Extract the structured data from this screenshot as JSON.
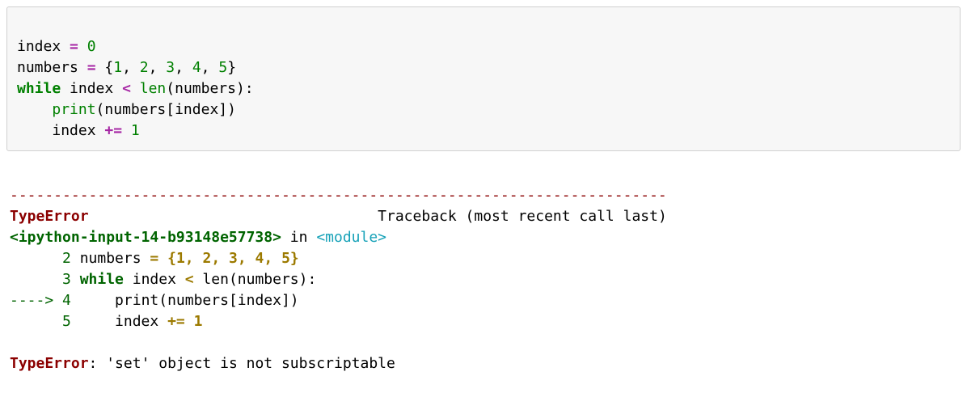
{
  "code": {
    "l1": {
      "v1": "index",
      "op": "=",
      "n1": "0"
    },
    "l2": {
      "v1": "numbers",
      "op": "=",
      "lb": "{",
      "n1": "1",
      "c1": ",",
      "n2": "2",
      "c2": ",",
      "n3": "3",
      "c3": ",",
      "n4": "4",
      "c4": ",",
      "n5": "5",
      "rb": "}"
    },
    "l3": {
      "kw": "while",
      "v1": "index",
      "op": "<",
      "fn": "len",
      "lp": "(",
      "v2": "numbers",
      "rp": "):"
    },
    "l4": {
      "fn": "print",
      "lp": "(",
      "v1": "numbers",
      "lb": "[",
      "v2": "index",
      "rb": "])"
    },
    "l5": {
      "v1": "index",
      "op": "+=",
      "n1": "1"
    }
  },
  "traceback": {
    "dash_line": "---------------------------------------------------------------------------",
    "err_name": "TypeError",
    "header_tail": "Traceback (most recent call last)",
    "frame_loc": "<ipython-input-14-b93148e57738>",
    "frame_in": " in ",
    "frame_mod": "<module>",
    "line2": {
      "num": "      2",
      "pre": " numbers ",
      "op": "=",
      "rest_open": " {",
      "n1": "1",
      "c1": ",",
      "sp1": " ",
      "n2": "2",
      "c2": ",",
      "sp2": " ",
      "n3": "3",
      "c3": ",",
      "sp3": " ",
      "n4": "4",
      "c4": ",",
      "sp4": " ",
      "n5": "5",
      "rest_close": "}"
    },
    "line3": {
      "num": "      3",
      "pre": " ",
      "kw": "while",
      "mid": " index ",
      "op": "<",
      "tail": " len(numbers):"
    },
    "line4": {
      "arrow": "----> ",
      "num": "4",
      "body": "     print(numbers[index])"
    },
    "line5": {
      "num": "      5",
      "pre": "     index ",
      "op": "+=",
      "n": " 1"
    },
    "final_err": "TypeError",
    "final_msg": ": 'set' object is not subscriptable"
  }
}
